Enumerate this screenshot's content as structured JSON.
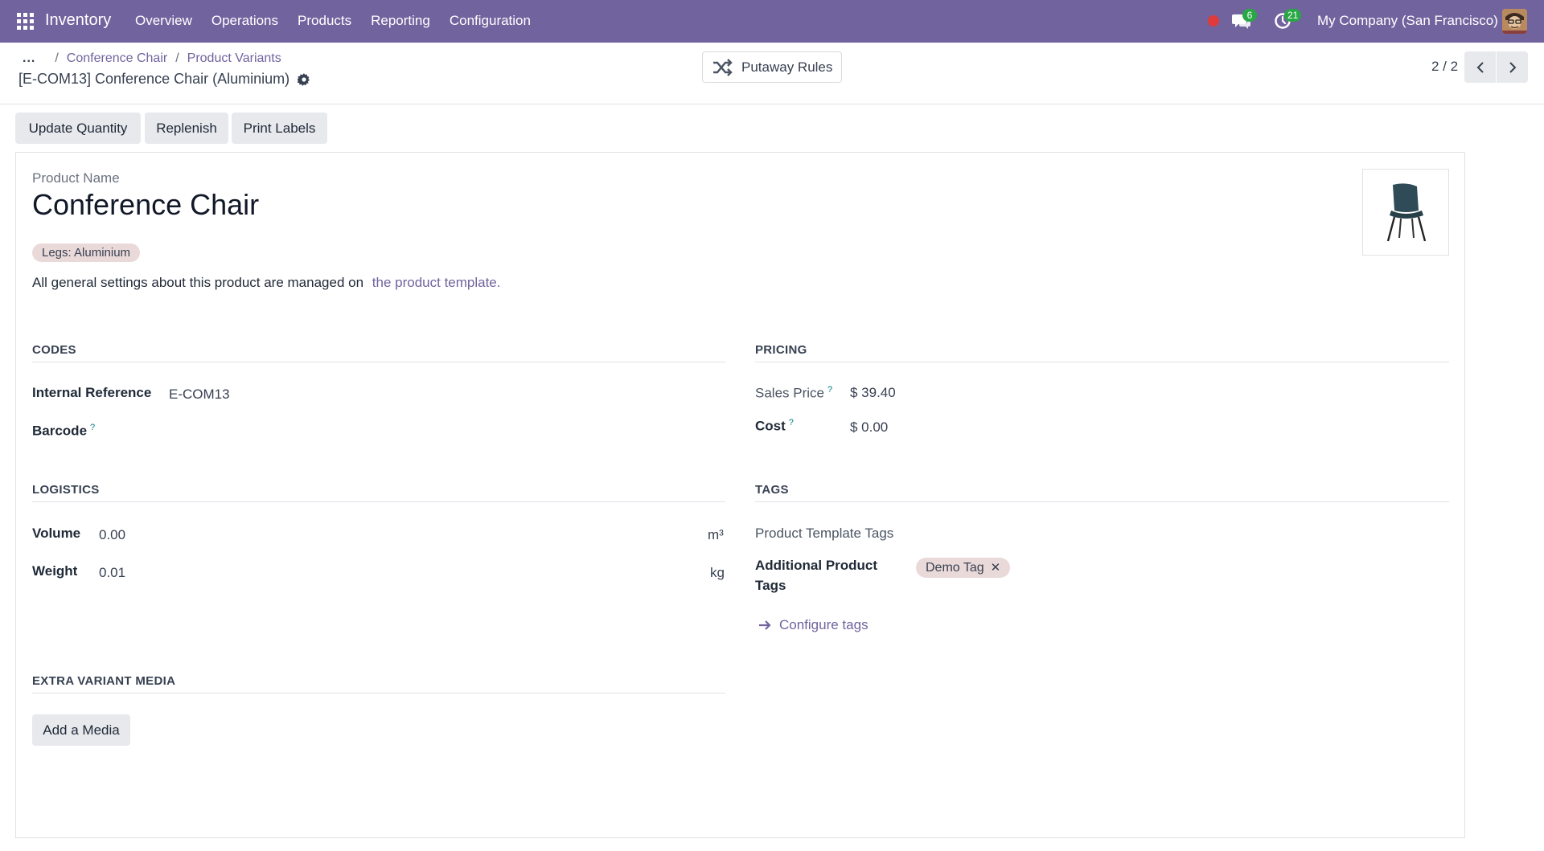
{
  "navbar": {
    "app_name": "Inventory",
    "menu": [
      "Overview",
      "Operations",
      "Products",
      "Reporting",
      "Configuration"
    ],
    "chat_count": "6",
    "activity_count": "21",
    "company": "My Company (San Francisco)",
    "colors": {
      "navbar_bg": "#71639e",
      "badge": "#28a745",
      "recording_dot": "#e03b3b"
    }
  },
  "breadcrumb": {
    "ellipsis": "...",
    "items": [
      "Conference Chair",
      "Product Variants"
    ],
    "separator": "/",
    "record_title": "[E-COM13] Conference Chair (Aluminium)"
  },
  "smart_button": {
    "label": "Putaway Rules",
    "icon": "shuffle-icon"
  },
  "pager": {
    "value": "2 / 2"
  },
  "actions": {
    "update_quantity": "Update Quantity",
    "replenish": "Replenish",
    "print_labels": "Print Labels"
  },
  "product": {
    "name_label": "Product Name",
    "name": "Conference Chair",
    "attribute_tag": "Legs: Aluminium",
    "note": "All general settings about this product are managed on",
    "note_link": "the product template."
  },
  "codes": {
    "title": "CODES",
    "internal_reference_label": "Internal Reference",
    "internal_reference": "E-COM13",
    "barcode_label": "Barcode",
    "help": "?"
  },
  "pricing": {
    "title": "PRICING",
    "sales_price_label": "Sales Price",
    "sales_price": "$ 39.40",
    "cost_label": "Cost",
    "cost": "$ 0.00"
  },
  "logistics": {
    "title": "LOGISTICS",
    "volume_label": "Volume",
    "volume": "0.00",
    "volume_unit": "m³",
    "weight_label": "Weight",
    "weight": "0.01",
    "weight_unit": "kg"
  },
  "tags": {
    "title": "TAGS",
    "template_tags_label": "Product Template Tags",
    "additional_tags_label_1": "Additional Product",
    "additional_tags_label_2": "Tags",
    "demo_tag": "Demo Tag",
    "remove_glyph": "✕",
    "configure": "Configure tags"
  },
  "media": {
    "title": "EXTRA VARIANT MEDIA",
    "add": "Add a Media"
  }
}
